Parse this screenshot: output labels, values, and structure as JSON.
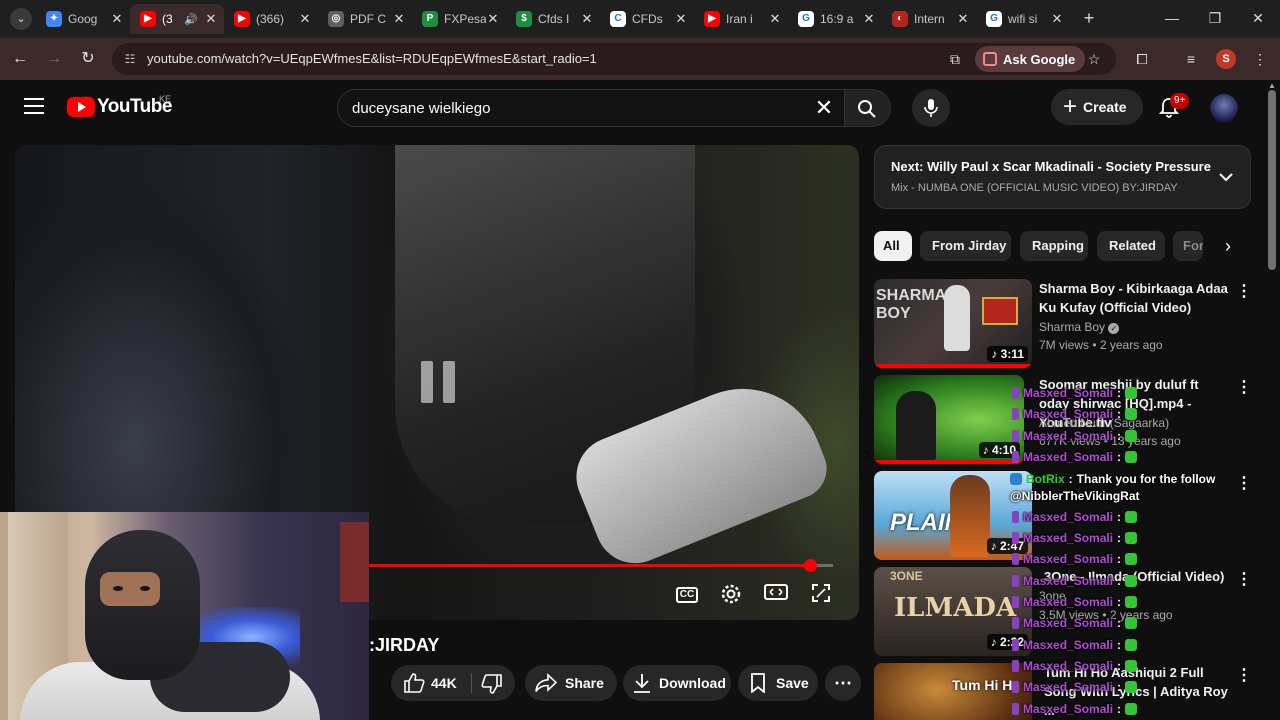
{
  "browser": {
    "tabs": [
      {
        "title": "Goog",
        "favicon": "gemini-icon",
        "color": "#4285f4",
        "glyph": "✦"
      },
      {
        "title": "(3",
        "favicon": "youtube-icon",
        "color": "#ff0000",
        "glyph": "▶",
        "active": true,
        "audio": true
      },
      {
        "title": "(366)",
        "favicon": "youtube-icon",
        "color": "#ff0000",
        "glyph": "▶"
      },
      {
        "title": "PDF C",
        "favicon": "pdf-tool-icon",
        "color": "#5f5f5f",
        "glyph": "◎"
      },
      {
        "title": "FXPesa",
        "favicon": "fxpesa-icon",
        "color": "#1f8f3f",
        "glyph": "P"
      },
      {
        "title": "Cfds I",
        "favicon": "cfds-icon",
        "color": "#1e8e3e",
        "glyph": "$"
      },
      {
        "title": "CFDs",
        "favicon": "cfds-c-icon",
        "color": "#ffffff",
        "glyph": "C"
      },
      {
        "title": "Iran i",
        "favicon": "youtube-icon",
        "color": "#ff0000",
        "glyph": "▶"
      },
      {
        "title": "16:9 a",
        "favicon": "google-icon",
        "color": "#4285f4",
        "glyph": "G"
      },
      {
        "title": "Intern",
        "favicon": "site-icon",
        "color": "#b3261e",
        "glyph": "◐"
      },
      {
        "title": "wifi si",
        "favicon": "google-icon",
        "color": "#4285f4",
        "glyph": "G"
      }
    ],
    "url": "youtube.com/watch?v=UEqpEWfmesE&list=RDUEqpEWfmesE&start_radio=1",
    "ask_google": "Ask Google",
    "profile_initial": "S"
  },
  "youtube": {
    "logo": "YouTube",
    "country": "KE",
    "search_value": "duceysane wielkiego",
    "create_label": "Create",
    "notif_badge": "9+"
  },
  "player": {
    "progress_fraction": 0.92,
    "video_title": ":JIRDAY",
    "likes": "44K",
    "share": "Share",
    "download": "Download",
    "save": "Save"
  },
  "next": {
    "label": "Next:",
    "title": "Willy Paul x Scar Mkadinali - Society Pressure",
    "subtitle": "Mix - NUMBA ONE (OFFICIAL MUSIC VIDEO) BY:JIRDAY"
  },
  "chips": [
    "All",
    "From Jirday",
    "Rapping",
    "Related",
    "For"
  ],
  "videos": [
    {
      "title": "Sharma Boy - Kibirkaaga Adaa Ku Kufay (Official Video)",
      "channel": "Sharma Boy",
      "verified": true,
      "meta": "7M views • 2 years ago",
      "duration": "3:11",
      "thumb_text": "SHARMA BOY"
    },
    {
      "title": "Soomar meshii by duluf ft oday shirwac [HQ].mp4 - YouTube.flv",
      "channel": "Ahmed Nuur (Sagaarka)",
      "meta": "677K views • 13 years ago",
      "duration": "4:10",
      "thumb_text": ""
    },
    {
      "title": "",
      "channel": "",
      "meta": "",
      "duration": "2:47",
      "thumb_text": "PLAIN"
    },
    {
      "title": "3One - Ilmada (Official Video)",
      "channel": "3one",
      "meta": "3.5M views • 2 years ago",
      "duration": "2:22",
      "thumb_text": "ILMADA"
    },
    {
      "title": "Tum Hi Ho Aashiqui 2 Full Song With Lyrics | Aditya Roy ...",
      "channel": "",
      "meta": "",
      "duration": "",
      "thumb_text": "Tum Hi H"
    }
  ],
  "chat": {
    "user": "Masxed_Somali",
    "bot_name": "BotRix",
    "bot_message": "Thank you for the follow",
    "bot_mention": "@NibblerTheVikingRat"
  }
}
